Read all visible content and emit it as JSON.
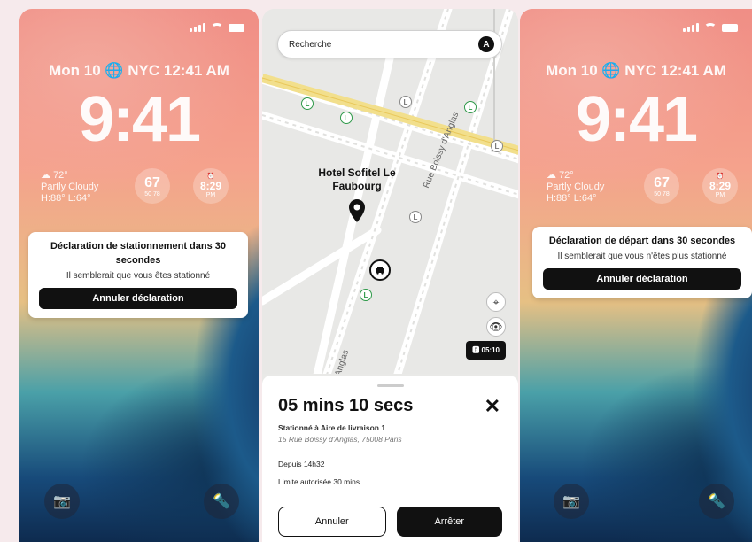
{
  "lockscreen": {
    "date": "Mon 10 🌐 NYC 12:41 AM",
    "time": "9:41",
    "weather": {
      "temp": "72°",
      "condition": "Partly Cloudy",
      "range": "H:88° L:64°"
    },
    "widget_temp": {
      "value": "67",
      "range": "50   78"
    },
    "widget_clock": {
      "value": "8:29",
      "suffix": "PM"
    }
  },
  "left_notification": {
    "title": "Déclaration de stationnement dans 30 secondes",
    "subtitle": "Il semblerait que vous êtes stationné",
    "button": "Annuler déclaration"
  },
  "right_notification": {
    "title": "Déclaration de départ dans 30 secondes",
    "subtitle": "Il semblerait que vous n'êtes plus stationné",
    "button": "Annuler déclaration"
  },
  "map": {
    "search_placeholder": "Recherche",
    "avatar_letter": "A",
    "hotel_label": "Hotel Sofitel Le Faubourg",
    "street_1": "Rue Boissy d'Anglas",
    "street_2": "d'Anglas",
    "poi_letter": "L",
    "timer_chip": "05:10"
  },
  "sheet": {
    "duration": "05 mins 10 secs",
    "parked_at": "Stationné à Aire de livraison 1",
    "address": "15 Rue Boissy d'Anglas, 75008 Paris",
    "since": "Depuis 14h32",
    "limit": "Limite autorisée 30 mins",
    "cancel_label": "Annuler",
    "stop_label": "Arrêter"
  },
  "colors": {
    "accent_green": "#2f9a4a",
    "dark": "#111111"
  }
}
